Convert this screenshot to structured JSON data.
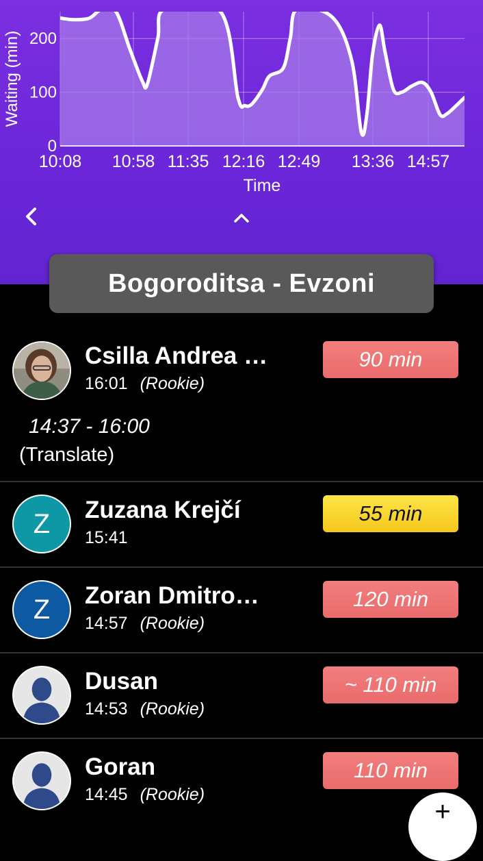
{
  "chart_data": {
    "type": "area",
    "xlabel": "Time",
    "ylabel": "Waiting (min)",
    "ylim": [
      0,
      250
    ],
    "y_ticks": [
      "0",
      "100",
      "200"
    ],
    "x_tick_labels": [
      "10:08",
      "10:58",
      "11:35",
      "12:16",
      "12:49",
      "13:36",
      "14:57"
    ],
    "grid": true,
    "line_color": "#ffffff",
    "fill_color": "#a67ae8",
    "series": [
      {
        "points": [
          [
            0,
            238
          ],
          [
            20,
            235
          ],
          [
            42,
            238
          ],
          [
            60,
            255
          ],
          [
            80,
            250
          ],
          [
            100,
            180
          ],
          [
            118,
            120
          ],
          [
            125,
            115
          ],
          [
            140,
            200
          ],
          [
            150,
            255
          ],
          [
            230,
            250
          ],
          [
            255,
            90
          ],
          [
            265,
            75
          ],
          [
            275,
            78
          ],
          [
            290,
            105
          ],
          [
            300,
            130
          ],
          [
            320,
            145
          ],
          [
            330,
            200
          ],
          [
            340,
            255
          ],
          [
            390,
            240
          ],
          [
            418,
            160
          ],
          [
            432,
            25
          ],
          [
            440,
            60
          ],
          [
            448,
            170
          ],
          [
            458,
            225
          ],
          [
            466,
            175
          ],
          [
            478,
            105
          ],
          [
            490,
            100
          ],
          [
            505,
            112
          ],
          [
            520,
            118
          ],
          [
            532,
            100
          ],
          [
            545,
            58
          ],
          [
            555,
            60
          ],
          [
            568,
            75
          ],
          [
            580,
            90
          ]
        ]
      }
    ]
  },
  "nav": {
    "back_icon": "chevron-left-icon",
    "collapse_icon": "chevron-up-icon"
  },
  "route_title": "Bogoroditsa - Evzoni",
  "colors": {
    "header": "#6a26d8",
    "badge_red": "#ea6b6b",
    "badge_yellow": "#f6c71c",
    "background": "#000000"
  },
  "drivers": [
    {
      "name": "Csilla Andrea …",
      "time": "16:01",
      "tag": "(Rookie)",
      "wait": "90 min",
      "status": "red",
      "avatar": "photo",
      "extra_time": "14:37 - 16:00",
      "extra_link": "(Translate)"
    },
    {
      "name": "Zuzana Krejčí",
      "time": "15:41",
      "tag": "",
      "wait": "55 min",
      "status": "yellow",
      "avatar": "letter",
      "avatar_letter": "Z",
      "avatar_color": "#0e97a4"
    },
    {
      "name": "Zoran Dmitro…",
      "time": "14:57",
      "tag": "(Rookie)",
      "wait": "120 min",
      "status": "red",
      "avatar": "letter",
      "avatar_letter": "Z",
      "avatar_color": "#0d5aa3"
    },
    {
      "name": "Dusan",
      "time": "14:53",
      "tag": "(Rookie)",
      "wait": "~ 110 min",
      "status": "red",
      "avatar": "person-placeholder"
    },
    {
      "name": "Goran",
      "time": "14:45",
      "tag": "(Rookie)",
      "wait": "110 min",
      "status": "red",
      "avatar": "person-placeholder"
    }
  ],
  "fab": {
    "label": "+",
    "icon": "add-icon"
  }
}
